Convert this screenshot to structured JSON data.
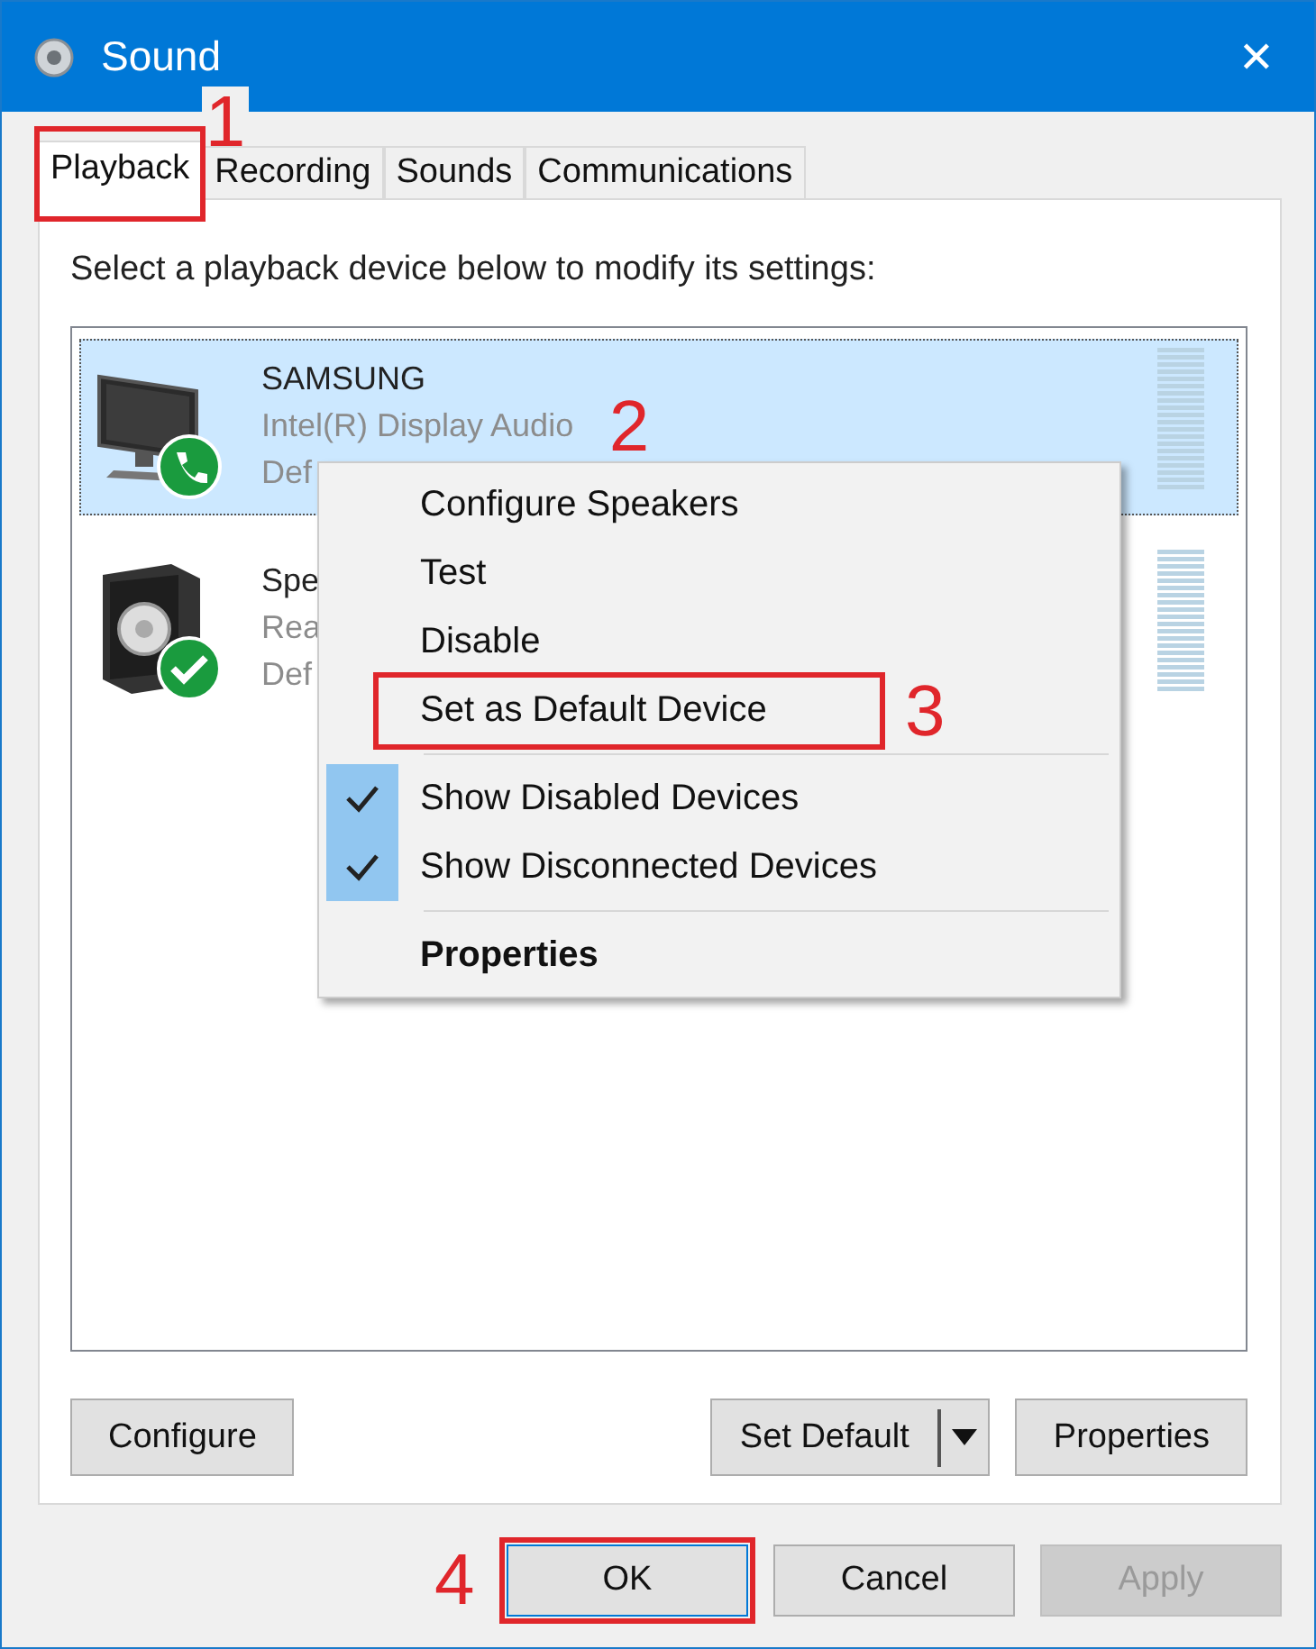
{
  "window": {
    "title": "Sound",
    "close": "✕"
  },
  "tabs": [
    {
      "label": "Playback",
      "selected": true,
      "callout": "1"
    },
    {
      "label": "Recording",
      "selected": false
    },
    {
      "label": "Sounds",
      "selected": false
    },
    {
      "label": "Communications",
      "selected": false
    }
  ],
  "instruction": "Select a playback device below to modify its settings:",
  "devices": [
    {
      "kind": "monitor",
      "default_comms": true,
      "default_device": false,
      "name": "SAMSUNG",
      "description": "Intel(R) Display Audio",
      "status": "Def",
      "selected": true,
      "callout": "2"
    },
    {
      "kind": "speaker",
      "default_comms": false,
      "default_device": true,
      "name": "Spe",
      "description": "Rea",
      "status": "Def",
      "selected": false
    }
  ],
  "context_menu": {
    "groups": [
      [
        {
          "label": "Configure Speakers",
          "checked": false,
          "bold": false
        },
        {
          "label": "Test",
          "checked": false,
          "bold": false
        },
        {
          "label": "Disable",
          "checked": false,
          "bold": false
        },
        {
          "label": "Set as Default Device",
          "checked": false,
          "bold": false,
          "callout": "3"
        }
      ],
      [
        {
          "label": "Show Disabled Devices",
          "checked": true,
          "bold": false
        },
        {
          "label": "Show Disconnected Devices",
          "checked": true,
          "bold": false
        }
      ],
      [
        {
          "label": "Properties",
          "checked": false,
          "bold": true
        }
      ]
    ]
  },
  "panel_buttons": {
    "configure": "Configure",
    "set_default": "Set Default",
    "properties": "Properties"
  },
  "dialog_buttons": [
    {
      "label": "OK",
      "disabled": false,
      "callout": "4"
    },
    {
      "label": "Cancel",
      "disabled": false
    },
    {
      "label": "Apply",
      "disabled": true
    }
  ]
}
